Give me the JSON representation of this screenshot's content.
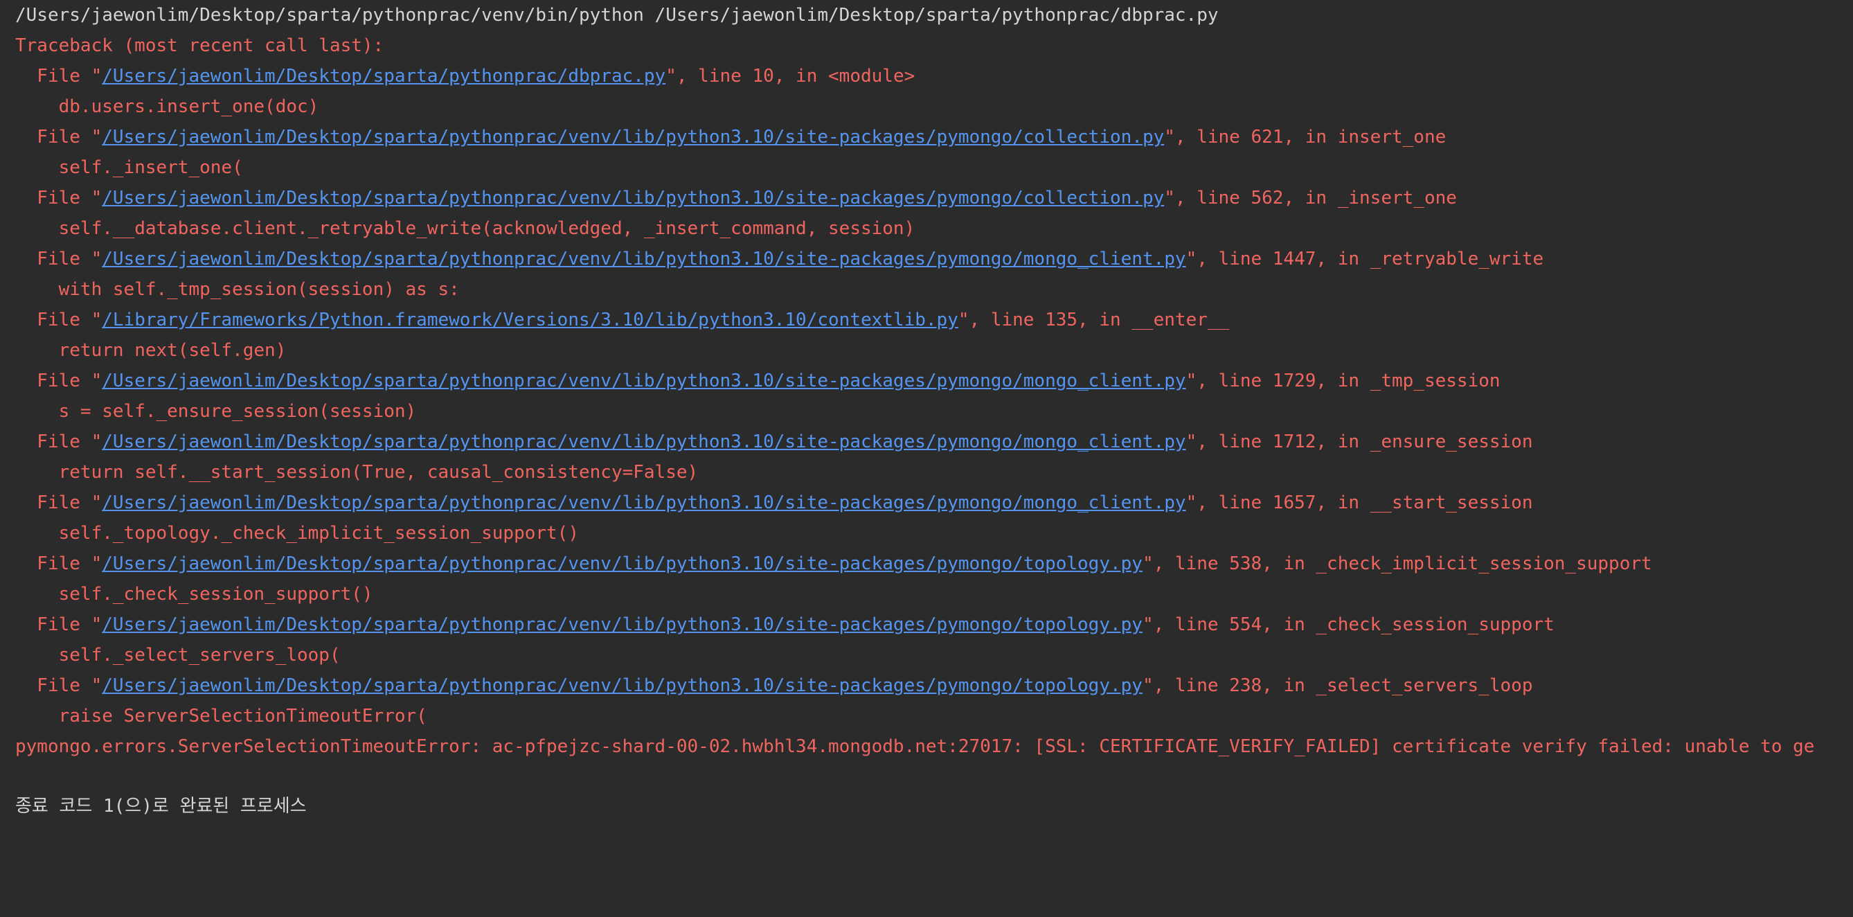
{
  "command": "/Users/jaewonlim/Desktop/sparta/pythonprac/venv/bin/python /Users/jaewonlim/Desktop/sparta/pythonprac/dbprac.py",
  "traceback_header": "Traceback (most recent call last):",
  "frames": [
    {
      "path": "/Users/jaewonlim/Desktop/sparta/pythonprac/dbprac.py",
      "location": "\", line 10, in <module>",
      "code": "db.users.insert_one(doc)"
    },
    {
      "path": "/Users/jaewonlim/Desktop/sparta/pythonprac/venv/lib/python3.10/site-packages/pymongo/collection.py",
      "location": "\", line 621, in insert_one",
      "code": "self._insert_one("
    },
    {
      "path": "/Users/jaewonlim/Desktop/sparta/pythonprac/venv/lib/python3.10/site-packages/pymongo/collection.py",
      "location": "\", line 562, in _insert_one",
      "code": "self.__database.client._retryable_write(acknowledged, _insert_command, session)"
    },
    {
      "path": "/Users/jaewonlim/Desktop/sparta/pythonprac/venv/lib/python3.10/site-packages/pymongo/mongo_client.py",
      "location": "\", line 1447, in _retryable_write",
      "code": "with self._tmp_session(session) as s:"
    },
    {
      "path": "/Library/Frameworks/Python.framework/Versions/3.10/lib/python3.10/contextlib.py",
      "location": "\", line 135, in __enter__",
      "code": "return next(self.gen)"
    },
    {
      "path": "/Users/jaewonlim/Desktop/sparta/pythonprac/venv/lib/python3.10/site-packages/pymongo/mongo_client.py",
      "location": "\", line 1729, in _tmp_session",
      "code": "s = self._ensure_session(session)"
    },
    {
      "path": "/Users/jaewonlim/Desktop/sparta/pythonprac/venv/lib/python3.10/site-packages/pymongo/mongo_client.py",
      "location": "\", line 1712, in _ensure_session",
      "code": "return self.__start_session(True, causal_consistency=False)"
    },
    {
      "path": "/Users/jaewonlim/Desktop/sparta/pythonprac/venv/lib/python3.10/site-packages/pymongo/mongo_client.py",
      "location": "\", line 1657, in __start_session",
      "code": "self._topology._check_implicit_session_support()"
    },
    {
      "path": "/Users/jaewonlim/Desktop/sparta/pythonprac/venv/lib/python3.10/site-packages/pymongo/topology.py",
      "location": "\", line 538, in _check_implicit_session_support",
      "code": "self._check_session_support()"
    },
    {
      "path": "/Users/jaewonlim/Desktop/sparta/pythonprac/venv/lib/python3.10/site-packages/pymongo/topology.py",
      "location": "\", line 554, in _check_session_support",
      "code": "self._select_servers_loop("
    },
    {
      "path": "/Users/jaewonlim/Desktop/sparta/pythonprac/venv/lib/python3.10/site-packages/pymongo/topology.py",
      "location": "\", line 238, in _select_servers_loop",
      "code": "raise ServerSelectionTimeoutError("
    }
  ],
  "error_message": "pymongo.errors.ServerSelectionTimeoutError: ac-pfpejzc-shard-00-02.hwbhl34.mongodb.net:27017: [SSL: CERTIFICATE_VERIFY_FAILED] certificate verify failed: unable to ge",
  "exit_message": "종료 코드 1(으)로 완료된 프로세스",
  "colors": {
    "background": "#2b2b2b",
    "plain_text": "#d4d4d4",
    "error_text": "#f0655f",
    "link": "#5495f2"
  }
}
